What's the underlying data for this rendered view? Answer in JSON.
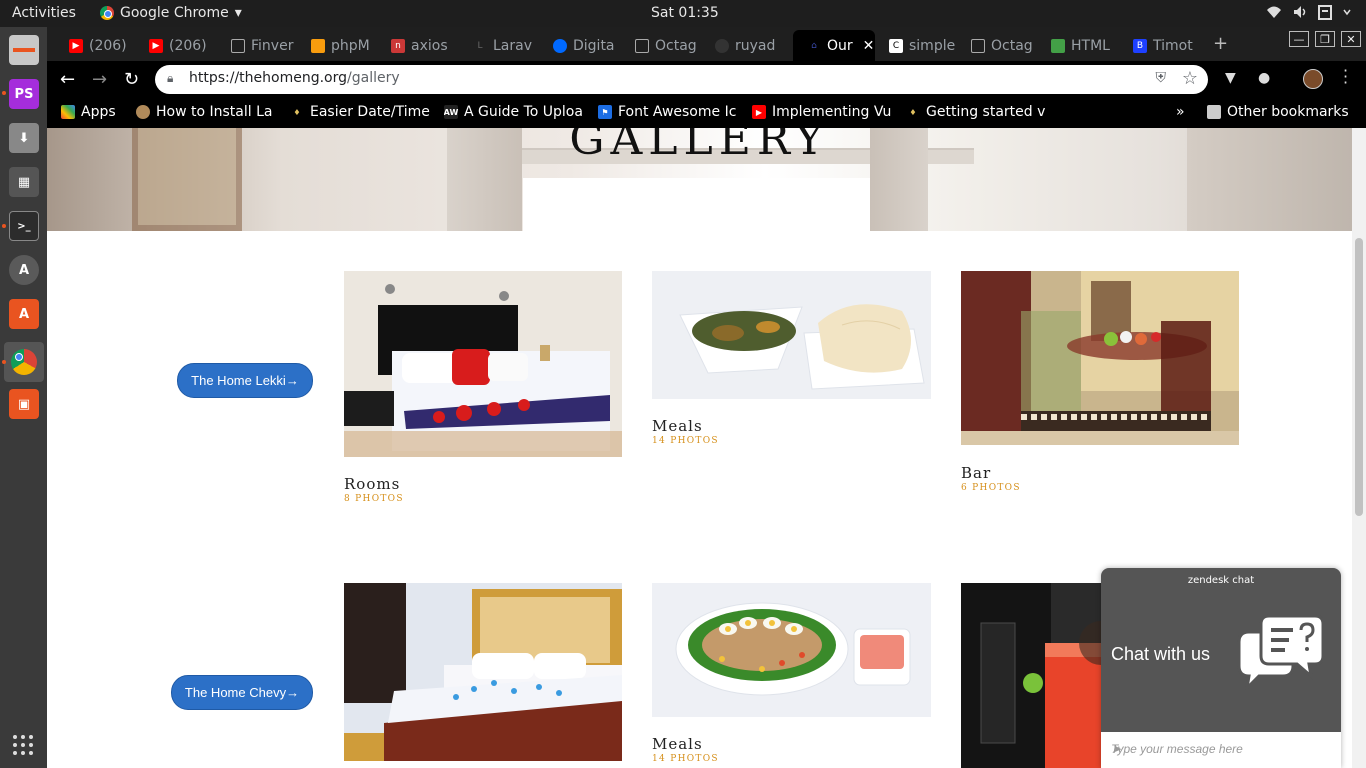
{
  "system_bar": {
    "activities": "Activities",
    "app_name": "Google Chrome",
    "app_menu_arrow": "▾",
    "clock": "Sat 01:35",
    "tray_icons": [
      "wifi-icon",
      "volume-icon",
      "clipboard-icon",
      "power-icon"
    ]
  },
  "dock": {
    "items": [
      {
        "name": "files-icon",
        "color": "#c8c8c8"
      },
      {
        "name": "phpstorm-icon",
        "label": "PS",
        "color": "#a52ddb"
      },
      {
        "name": "installer-icon",
        "color": "#888888"
      },
      {
        "name": "video-editor-icon",
        "color": "#555555"
      },
      {
        "name": "terminal-icon",
        "label": ">_",
        "color": "#2c2c2c"
      },
      {
        "name": "updater-icon",
        "label": "A",
        "color": "#5a5a5a"
      },
      {
        "name": "software-center-icon",
        "color": "#e95420"
      },
      {
        "name": "chrome-icon",
        "color": "#4285f4"
      },
      {
        "name": "screenshot-icon",
        "color": "#e95420"
      }
    ]
  },
  "tabs": [
    {
      "title": "(206)",
      "favicon": "youtube-icon",
      "color": "#ff0000"
    },
    {
      "title": "(206)",
      "favicon": "youtube-icon",
      "color": "#ff0000"
    },
    {
      "title": "Finver",
      "favicon": "page-icon",
      "color": "#333333"
    },
    {
      "title": "phpM",
      "favicon": "phpmyadmin-icon",
      "color": "#f89c0e"
    },
    {
      "title": "axios",
      "favicon": "npm-icon",
      "color": "#cb3837"
    },
    {
      "title": "Larav",
      "favicon": "laravel-icon",
      "color": "#333333"
    },
    {
      "title": "Digita",
      "favicon": "digitalocean-icon",
      "color": "#0069ff"
    },
    {
      "title": "Octag",
      "favicon": "page-icon",
      "color": "#333333"
    },
    {
      "title": "ruyad",
      "favicon": "github-icon",
      "color": "#333333"
    },
    {
      "title": "Our",
      "favicon": "site-icon",
      "color": "#1a237e"
    },
    {
      "title": "simple",
      "favicon": "c-icon",
      "color": "#ffffff"
    },
    {
      "title": "Octag",
      "favicon": "page-icon",
      "color": "#333333"
    },
    {
      "title": "HTML",
      "favicon": "html-icon",
      "color": "#43a047"
    },
    {
      "title": "Timot",
      "favicon": "bootstrap-icon",
      "color": "#1e40ff"
    }
  ],
  "address_bar": {
    "url_host": "https://thehomeng.org",
    "url_path": "/gallery"
  },
  "bookmarks": [
    {
      "label": "Apps",
      "icon": "apps-grid-icon",
      "color": "#ea4335"
    },
    {
      "label": "How to Install La",
      "icon": "globe-icon",
      "color": "#b08a5a"
    },
    {
      "label": "Easier Date/Time",
      "icon": "bulb-icon",
      "color": "#e0c060"
    },
    {
      "label": "A Guide To Uploa",
      "icon": "aw-icon",
      "color": "#222222"
    },
    {
      "label": "Font Awesome Ic",
      "icon": "flag-icon",
      "color": "#1c6de4"
    },
    {
      "label": "Implementing Vu",
      "icon": "youtube-icon",
      "color": "#ff0000"
    },
    {
      "label": "Getting started v",
      "icon": "bulb-icon",
      "color": "#e0c060"
    },
    {
      "label": "»",
      "icon": "overflow-icon",
      "color": "#ffffff"
    },
    {
      "label": "Other bookmarks",
      "icon": "folder-icon",
      "color": "#cccccc"
    }
  ],
  "page": {
    "hero_title": "GALLERY",
    "locations": [
      {
        "button": "The Home Lekki→",
        "cards": [
          {
            "title": "Rooms",
            "count": "8 PHOTOS",
            "image": "bedroom-photo"
          },
          {
            "title": "Meals",
            "count": "14 PHOTOS",
            "image": "meal-photo"
          },
          {
            "title": "Bar",
            "count": "6 PHOTOS",
            "image": "bar-terrace-photo"
          }
        ]
      },
      {
        "button": "The Home Chevy→",
        "cards": [
          {
            "title": "",
            "count": "",
            "image": "bedroom-photo-2"
          },
          {
            "title": "Meals",
            "count": "14 PHOTOS",
            "image": "salad-photo"
          },
          {
            "title": "",
            "count": "",
            "image": "cocktail-photo"
          }
        ]
      }
    ]
  },
  "chat_widget": {
    "brand": "zendesk chat",
    "cta": "Chat with us",
    "placeholder": "Type your message here"
  },
  "colors": {
    "button_blue": "#2c70c7",
    "photo_count": "#d6901b",
    "zendesk_bg": "#555555"
  }
}
